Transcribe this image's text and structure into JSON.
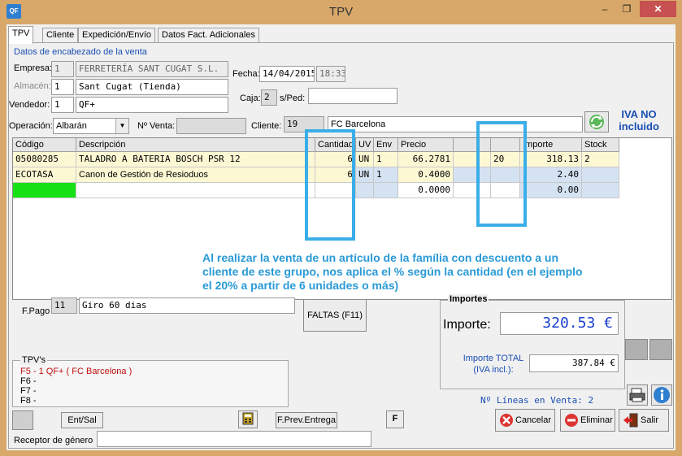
{
  "window": {
    "title": "TPV",
    "app_icon_text": "QF",
    "minimize": "–",
    "maximize": "❐",
    "close": "✕"
  },
  "tabs": [
    {
      "label": "TPV"
    },
    {
      "label": "Cliente"
    },
    {
      "label": "Expedición/Envío"
    },
    {
      "label": "Datos Fact. Adicionales"
    }
  ],
  "header": {
    "section_label": "Datos de encabezado de la venta",
    "empresa_label": "Empresa:",
    "empresa_code": "1",
    "empresa_name": "FERRETERÍA SANT CUGAT S.L.",
    "almacen_label": "Almacén:",
    "almacen_code": "1",
    "almacen_name": "Sant Cugat (Tienda)",
    "vendedor_label": "Vendedor:",
    "vendedor_code": "1",
    "vendedor_name": "QF+",
    "fecha_label": "Fecha:",
    "fecha": "14/04/2015",
    "hora": "18:33",
    "caja_label": "Caja:",
    "caja": "2",
    "sped_label": "s/Ped:",
    "sped": "",
    "operacion_label": "Operación:",
    "operacion": "Albarán",
    "nventa_label": "Nº Venta:",
    "nventa": "",
    "cliente_label": "Cliente:",
    "cliente_code": "19",
    "cliente_name": "FC Barcelona",
    "iva_line1": "IVA NO",
    "iva_line2": "incluido"
  },
  "grid": {
    "columns": [
      "Código",
      "Descripción",
      "Cantidad",
      "UV",
      "Env",
      "Precio",
      "",
      "",
      "Importe",
      "Stock"
    ],
    "rows": [
      [
        "05080285",
        "TALADRO A BATERIA BOSCH PSR 12",
        "6",
        "UN",
        "1",
        "66.2781",
        "",
        "20",
        "318.13",
        "2"
      ],
      [
        "ECOTASA",
        "Canon de Gestión de Resioduos",
        "6",
        "UN",
        "1",
        "0.4000",
        "",
        "",
        "2.40",
        ""
      ],
      [
        "",
        "",
        "",
        "",
        "",
        "0.0000",
        "",
        "",
        "0.00",
        ""
      ]
    ]
  },
  "annotation": "Al realizar la venta de un artículo de la família con descuento a un cliente de este grupo, nos aplica el % según la cantidad (en el ejemplo el 20% a partir de 6 unidades o más)",
  "payment": {
    "fpago_label": "F.Pago",
    "fpago_code": "11",
    "fpago_name": "Giro 60 dias",
    "faltas_button": "FALTAS (F11)"
  },
  "importes": {
    "group_title": "Importes",
    "importe_label": "Importe:",
    "importe_value": "320.53 €",
    "total_label_line1": "Importe TOTAL",
    "total_label_line2": "(IVA incl.):",
    "total_value": "387.84 €",
    "lineas_text": "Nº Líneas en Venta: 2"
  },
  "tpvs": {
    "title": "TPV's",
    "items": [
      "F5 - 1 QF+ ( FC Barcelona )",
      "F6 -",
      "F7 -",
      "F8 -"
    ]
  },
  "bottom": {
    "ent_sal": "Ent/Sal",
    "prev_entrega": "F.Prev.Entrega",
    "f_button": "F",
    "receptor_label": "Receptor de género",
    "receptor_value": "",
    "cancelar": "Cancelar",
    "eliminar": "Eliminar",
    "salir": "Salir"
  },
  "colors": {
    "accent_blue": "#1a4fb3",
    "note_blue": "#2a9ad6",
    "grid_green": "#16e016",
    "grid_yellow": "#fdf8d4",
    "grid_blue": "#d4e2f2"
  }
}
